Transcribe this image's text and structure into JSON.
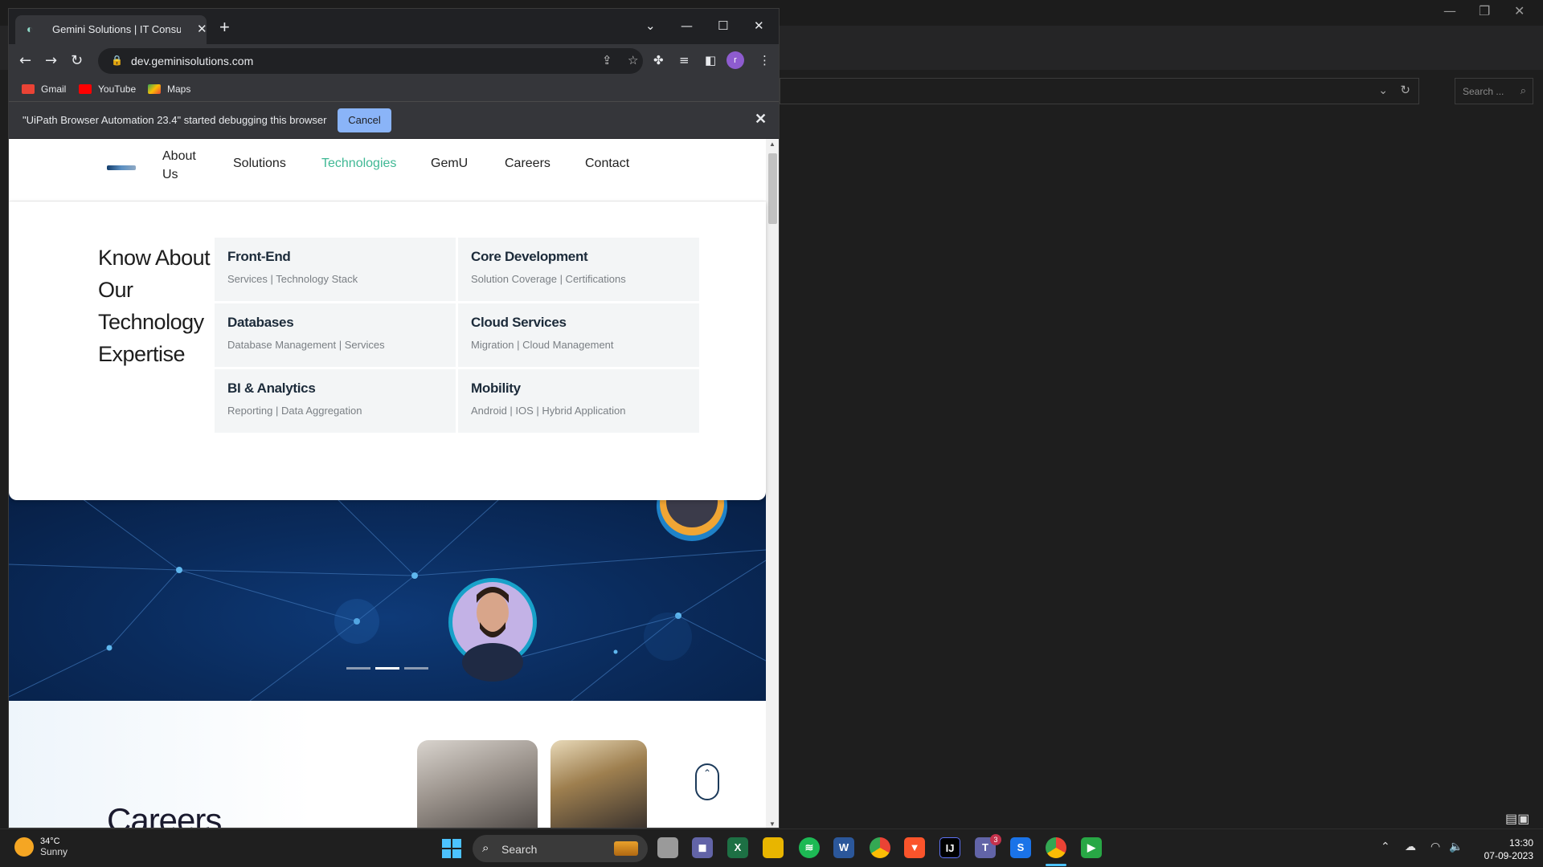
{
  "bg_app": {
    "search_placeholder": "Search ..."
  },
  "browser": {
    "tab_title": "Gemini Solutions | IT Consulting,",
    "url": "dev.geminisolutions.com",
    "profile_initial": "r",
    "bookmarks": [
      "Gmail",
      "YouTube",
      "Maps"
    ],
    "infobar_message": "\"UiPath Browser Automation 23.4\" started debugging this browser",
    "infobar_cancel": "Cancel"
  },
  "site": {
    "nav": [
      {
        "label": "About Us"
      },
      {
        "label": "Solutions"
      },
      {
        "label": "Technologies",
        "active": true
      },
      {
        "label": "GemU"
      },
      {
        "label": "Careers"
      },
      {
        "label": "Contact"
      }
    ],
    "mega_heading": "Know About Our Technology Expertise",
    "cards": [
      {
        "title": "Front-End",
        "subtitle": "Services | Technology Stack"
      },
      {
        "title": "Core Development",
        "subtitle": "Solution Coverage | Certifications"
      },
      {
        "title": "Databases",
        "subtitle": "Database Management | Services"
      },
      {
        "title": "Cloud Services",
        "subtitle": "Migration | Cloud Management"
      },
      {
        "title": "BI & Analytics",
        "subtitle": "Reporting | Data Aggregation"
      },
      {
        "title": "Mobility",
        "subtitle": "Android | IOS | Hybrid Application"
      }
    ],
    "carousel_active_index": 1,
    "careers_heading": "Careers"
  },
  "taskbar": {
    "temperature": "34°C",
    "weather": "Sunny",
    "search_label": "Search",
    "teams_badge": "3",
    "time": "13:30",
    "date": "07-09-2023"
  },
  "colors": {
    "accent_active_nav": "#3fb894",
    "infobar_button": "#8ab4f8",
    "hero_bg": "#0a2b5c"
  }
}
